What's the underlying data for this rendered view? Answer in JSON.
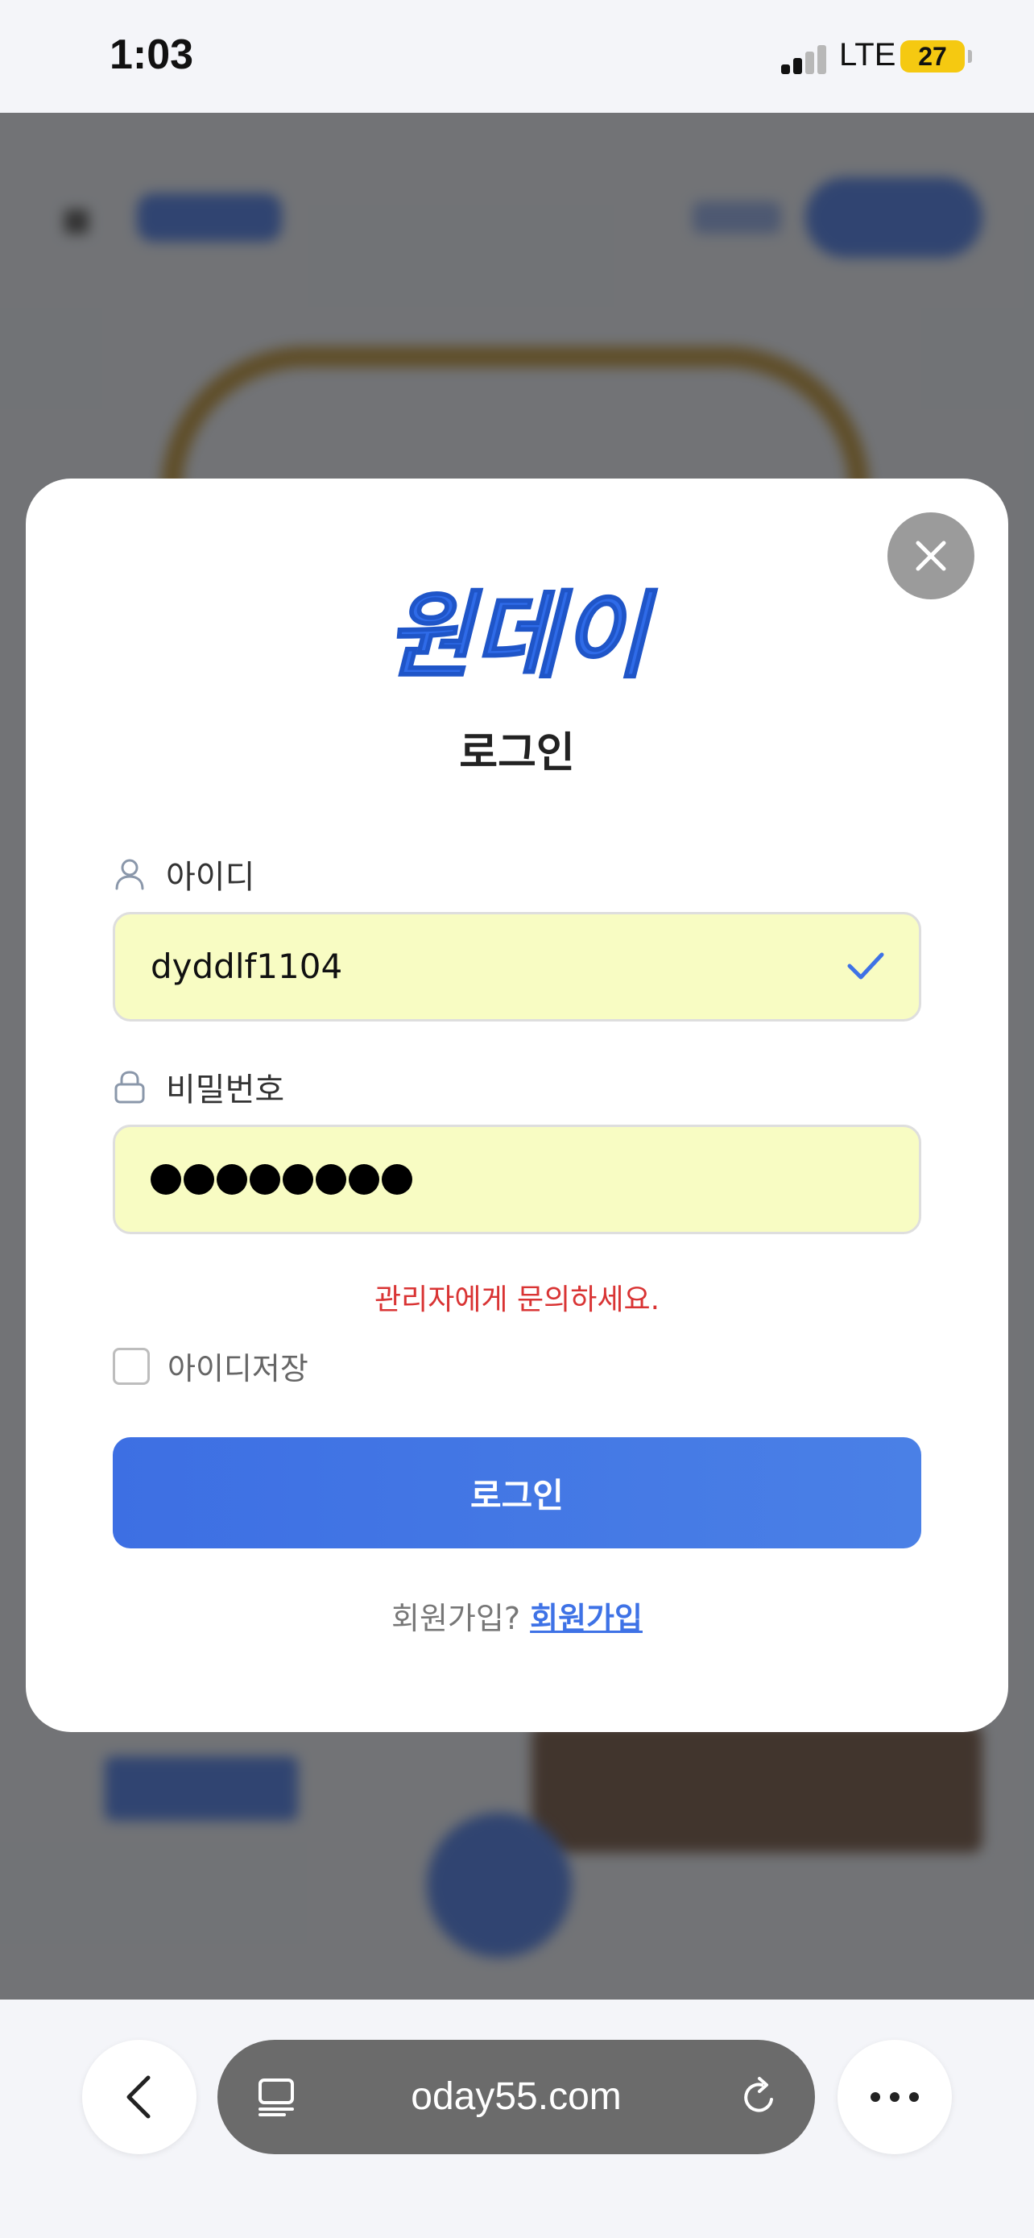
{
  "status_bar": {
    "time": "1:03",
    "network": "LTE",
    "battery": "27"
  },
  "modal": {
    "logo_text": "원데이",
    "title": "로그인",
    "id_label": "아이디",
    "id_value": "dyddlf1104",
    "password_label": "비밀번호",
    "password_masked": "●●●●●●●●",
    "error_message": "관리자에게 문의하세요.",
    "remember_label": "아이디저장",
    "login_button": "로그인",
    "signup_prompt": "회원가입?",
    "signup_link": "회원가입"
  },
  "browser": {
    "url": "oday55.com"
  },
  "colors": {
    "accent": "#3e72e6",
    "error": "#d93434",
    "autofill": "#f8fcc3"
  }
}
